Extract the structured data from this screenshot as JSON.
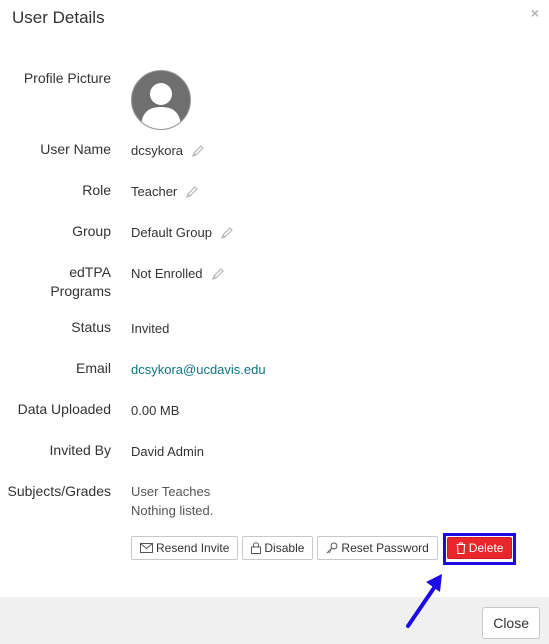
{
  "dialog": {
    "title": "User Details",
    "close_glyph": "×"
  },
  "fields": {
    "profile_picture": {
      "label": "Profile Picture"
    },
    "user_name": {
      "label": "User Name",
      "value": "dcsykora"
    },
    "role": {
      "label": "Role",
      "value": "Teacher"
    },
    "group": {
      "label": "Group",
      "value": "Default Group"
    },
    "edtpa": {
      "label_line1": "edTPA",
      "label_line2": "Programs",
      "value": "Not Enrolled"
    },
    "status": {
      "label": "Status",
      "value": "Invited"
    },
    "email": {
      "label": "Email",
      "value": "dcsykora@ucdavis.edu"
    },
    "data_uploaded": {
      "label": "Data Uploaded",
      "value": "0.00 MB"
    },
    "invited_by": {
      "label": "Invited By",
      "value": "David Admin"
    },
    "subjects": {
      "label": "Subjects/Grades",
      "line1": "User Teaches",
      "line2": "Nothing listed."
    }
  },
  "actions": {
    "resend_invite": "Resend Invite",
    "disable": "Disable",
    "reset_password": "Reset Password",
    "delete": "Delete"
  },
  "footer": {
    "close_label": "Close"
  },
  "colors": {
    "link": "#0e7385",
    "delete": "#e8262c",
    "highlight": "#1c0ae6",
    "footer_bg": "#f0f0f0"
  },
  "icons": {
    "edit": "pencil-icon",
    "envelope": "envelope-icon",
    "lock": "lock-icon",
    "key": "key-icon",
    "trash": "trash-icon",
    "avatar": "user-avatar-icon"
  }
}
